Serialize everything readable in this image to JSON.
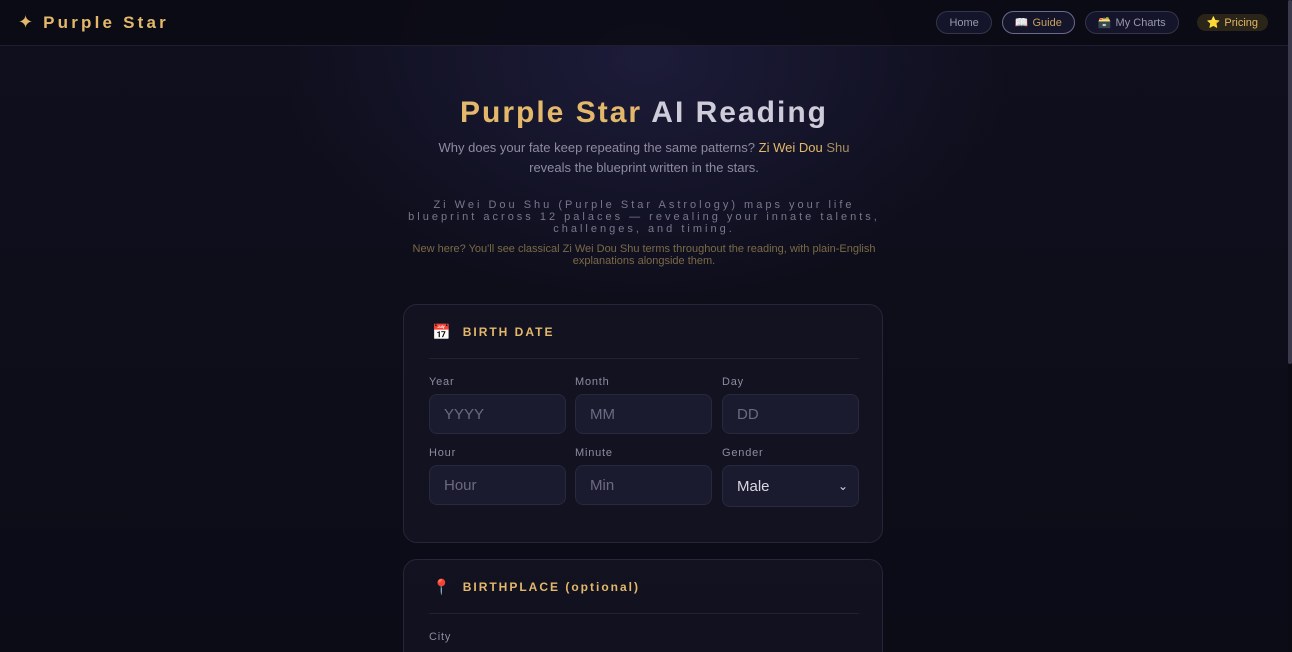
{
  "brand": {
    "icon": "four-point-star-icon",
    "name": "Purple Star"
  },
  "nav": {
    "home": "Home",
    "guide": "Guide",
    "guide_icon": "book-icon",
    "charts": "My Charts",
    "charts_icon": "card-file-box-icon",
    "pricing": "Pricing",
    "pricing_icon": "star-icon"
  },
  "hero": {
    "title_gold": "Purple Star",
    "title_rest": "AI Reading",
    "subtitle_a": "Why does your fate keep repeating the same patterns?",
    "subtitle_hl": "Zi Wei Dou",
    "subtitle_hl2": "Shu",
    "subtitle_b": "reveals the blueprint written in the stars.",
    "description": "Zi Wei Dou Shu (Purple Star Astrology) maps your life blueprint across 12 palaces — revealing your innate talents, challenges, and timing.",
    "note": "New here? You'll see classical Zi Wei Dou Shu terms throughout the reading, with plain-English explanations alongside them."
  },
  "birth_date": {
    "heading": "BIRTH DATE",
    "icon": "calendar-icon",
    "year": {
      "label": "Year",
      "placeholder": "YYYY"
    },
    "month": {
      "label": "Month",
      "placeholder": "MM"
    },
    "day": {
      "label": "Day",
      "placeholder": "DD"
    },
    "hour": {
      "label": "Hour",
      "placeholder": "Hour"
    },
    "minute": {
      "label": "Minute",
      "placeholder": "Min"
    },
    "gender": {
      "label": "Gender",
      "value": "Male"
    }
  },
  "birthplace": {
    "heading": "BIRTHPLACE (optional)",
    "icon": "map-pin-icon",
    "city": {
      "label": "City"
    }
  }
}
